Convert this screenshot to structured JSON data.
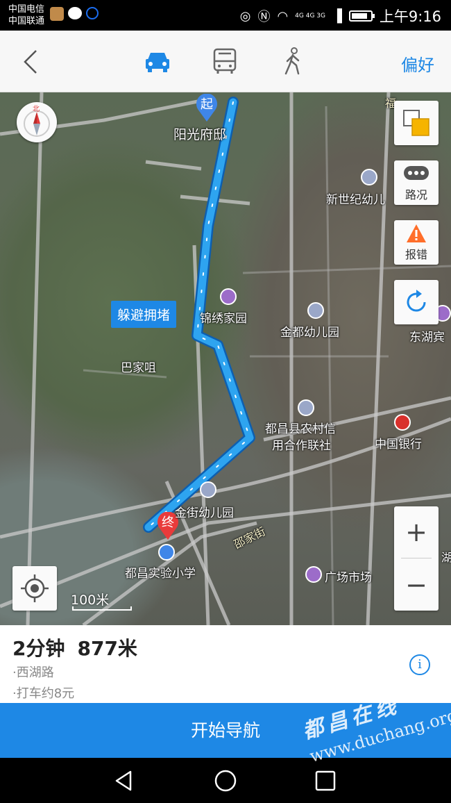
{
  "status_bar": {
    "carrier_1": "中国电信",
    "carrier_2": "中国联通",
    "network_label": "4G 4G 3G",
    "time": "上午9:16"
  },
  "header": {
    "modes": [
      {
        "name": "car-icon",
        "active": true
      },
      {
        "name": "bus-icon",
        "active": false
      },
      {
        "name": "walk-icon",
        "active": false
      }
    ],
    "preference_label": "偏好",
    "accent_color": "#1e88e5"
  },
  "map": {
    "compass_label": "北",
    "start_marker": "起",
    "end_marker": "终",
    "congestion_label": "躲避拥堵",
    "controls": {
      "traffic_label": "路况",
      "report_label": "报错"
    },
    "scale_label": "100米",
    "pois": [
      {
        "id": "yangguang",
        "label": "阳光府邸"
      },
      {
        "id": "xinshiji",
        "label": "新世纪幼儿"
      },
      {
        "id": "jinxiu",
        "label": "锦绣家园"
      },
      {
        "id": "jindu",
        "label": "金都幼儿园"
      },
      {
        "id": "donghu",
        "label": "东湖宾"
      },
      {
        "id": "bajiaju",
        "label": "巴家咀"
      },
      {
        "id": "nongxin_1",
        "label": "都昌县农村信"
      },
      {
        "id": "nongxin_2",
        "label": "用合作联社"
      },
      {
        "id": "boc",
        "label": "中国银行"
      },
      {
        "id": "jinjie",
        "label": "金街幼儿园"
      },
      {
        "id": "shaojiajie",
        "label": "邵家街"
      },
      {
        "id": "shiyan",
        "label": "都昌实验小学"
      },
      {
        "id": "guangchang",
        "label": "广场市场"
      },
      {
        "id": "fu",
        "label": "福"
      },
      {
        "id": "hu",
        "label": "湖"
      }
    ]
  },
  "route_summary": {
    "duration": "2分钟",
    "distance": "877米",
    "via": "·西湖路",
    "taxi": "·打车约8元",
    "info_icon": "i"
  },
  "start_button": "开始导航",
  "watermark": {
    "line1": "都昌在线",
    "line2": "www.duchang.org"
  }
}
